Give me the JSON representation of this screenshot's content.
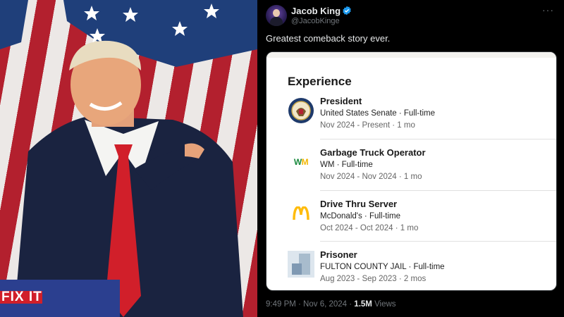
{
  "photo": {
    "sign_text": "FIX IT"
  },
  "tweet": {
    "author": {
      "name": "Jacob King",
      "handle": "@JacobKinge"
    },
    "more_label": "···",
    "text": "Greatest comeback story ever.",
    "timestamp": "9:49 PM · Nov 6, 2024 · ",
    "views_count": "1.5M",
    "views_label": " Views"
  },
  "experience_card": {
    "title": "Experience",
    "items": [
      {
        "role": "President",
        "organization": "United States Senate · Full-time",
        "dates": "Nov 2024 - Present · 1 mo",
        "logo": "senate-seal-icon"
      },
      {
        "role": "Garbage Truck Operator",
        "organization": "WM · Full-time",
        "dates": "Nov 2024 - Nov 2024 · 1 mo",
        "logo": "wm-logo-icon",
        "logo_text_a": "W",
        "logo_text_b": "M"
      },
      {
        "role": "Drive Thru Server",
        "organization": "McDonald's · Full-time",
        "dates": "Oct 2024 - Oct 2024 · 1 mo",
        "logo": "mcdonalds-logo-icon"
      },
      {
        "role": "Prisoner",
        "organization": "FULTON COUNTY JAIL · Full-time",
        "dates": "Aug 2023 - Sep 2023 · 2 mos",
        "logo": "company-placeholder-icon"
      }
    ]
  },
  "colors": {
    "background": "#000000",
    "text_primary": "#e7e9ea",
    "text_secondary": "#71767b",
    "verified_blue": "#1d9bf0",
    "card_background": "#ffffff"
  }
}
